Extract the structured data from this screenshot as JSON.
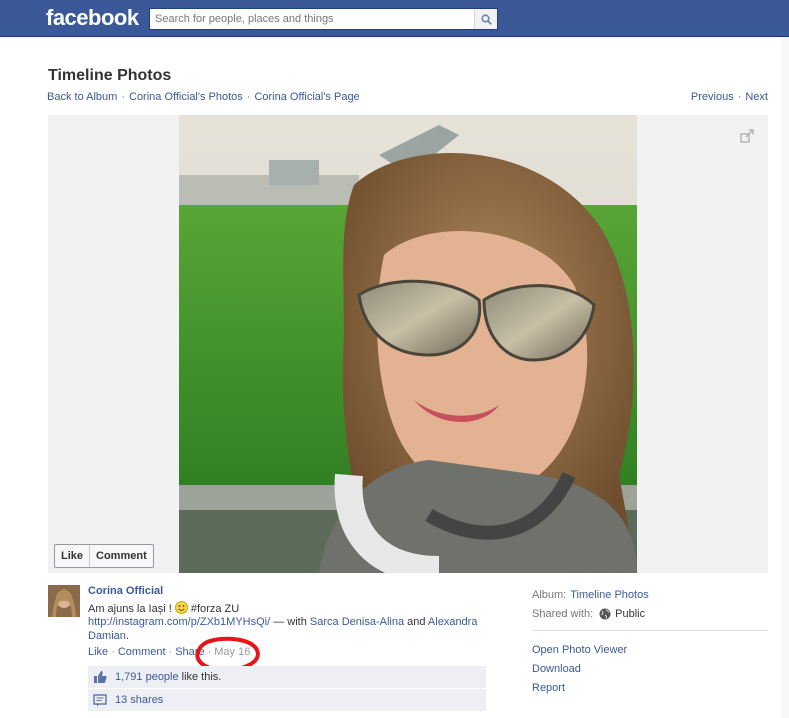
{
  "header": {
    "logo": "facebook",
    "search_placeholder": "Search for people, places and things"
  },
  "page": {
    "title": "Timeline Photos",
    "breadcrumbs": [
      "Back to Album",
      "Corina Official's Photos",
      "Corina Official's Page"
    ],
    "pager": {
      "previous": "Previous",
      "next": "Next"
    }
  },
  "photo_actions": {
    "like": "Like",
    "comment": "Comment"
  },
  "post": {
    "author": "Corina Official",
    "caption_text": "Am ajuns la Iași ! ",
    "caption_hashtag": " #forza ZU",
    "link": "http://instagram.com/p/ZXb1MYHsQi/",
    "with_prefix": " — with ",
    "tag1": "Sarca Denisa-Alina",
    "and": " and ",
    "tag2": "Alexandra Damian",
    "period": ".",
    "actions": {
      "like": "Like",
      "comment": "Comment",
      "share": "Share",
      "date": "May 16"
    },
    "likes_count": "1,791 people",
    "likes_suffix": "like this.",
    "shares": "13 shares"
  },
  "meta": {
    "album_label": "Album:",
    "album_value": "Timeline Photos",
    "shared_label": "Shared with:",
    "shared_value": "Public",
    "links": [
      "Open Photo Viewer",
      "Download",
      "Report"
    ]
  },
  "colors": {
    "brand": "#3b5998",
    "annotation_circle": "#e8141b"
  }
}
